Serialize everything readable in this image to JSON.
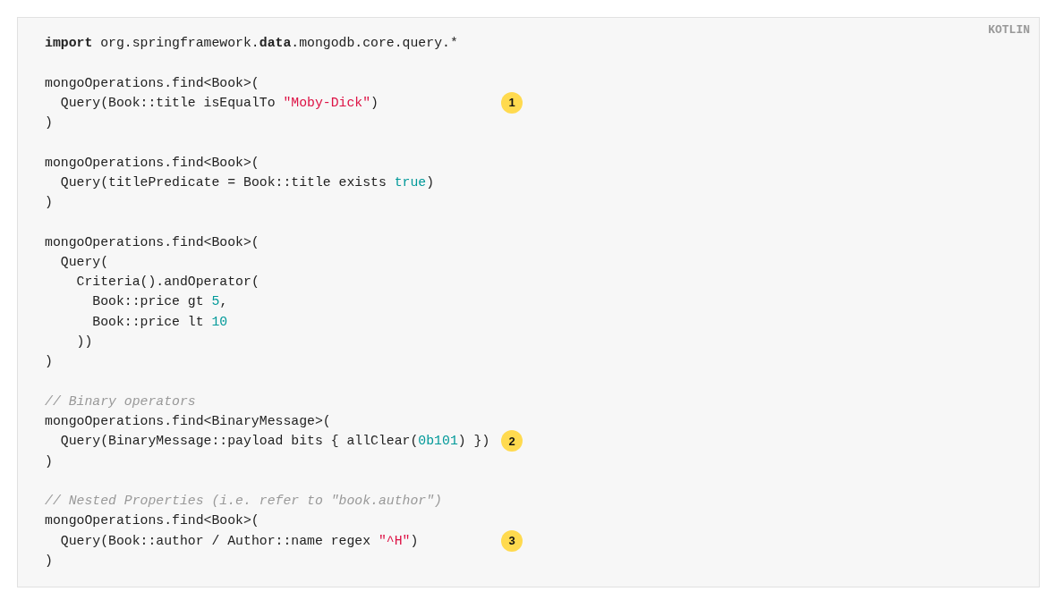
{
  "code_block": {
    "language": "KOTLIN",
    "lines": [
      {
        "kind": "code",
        "tokens": [
          {
            "kind": "keyword",
            "text": "import"
          },
          {
            "kind": "plain",
            "text": " org.springframework."
          },
          {
            "kind": "keyword",
            "text": "data"
          },
          {
            "kind": "plain",
            "text": ".mongodb.core.query.*"
          }
        ]
      },
      {
        "kind": "blank"
      },
      {
        "kind": "code",
        "tokens": [
          {
            "kind": "plain",
            "text": "mongoOperations.find<Book>("
          }
        ]
      },
      {
        "kind": "code",
        "tokens": [
          {
            "kind": "plain",
            "text": "  Query(Book::title isEqualTo "
          },
          {
            "kind": "string",
            "text": "\"Moby-Dick\""
          },
          {
            "kind": "plain",
            "text": ")"
          }
        ],
        "callout": "1"
      },
      {
        "kind": "code",
        "tokens": [
          {
            "kind": "plain",
            "text": ")"
          }
        ]
      },
      {
        "kind": "blank"
      },
      {
        "kind": "code",
        "tokens": [
          {
            "kind": "plain",
            "text": "mongoOperations.find<Book>("
          }
        ]
      },
      {
        "kind": "code",
        "tokens": [
          {
            "kind": "plain",
            "text": "  Query(titlePredicate = Book::title exists "
          },
          {
            "kind": "literal",
            "text": "true"
          },
          {
            "kind": "plain",
            "text": ")"
          }
        ]
      },
      {
        "kind": "code",
        "tokens": [
          {
            "kind": "plain",
            "text": ")"
          }
        ]
      },
      {
        "kind": "blank"
      },
      {
        "kind": "code",
        "tokens": [
          {
            "kind": "plain",
            "text": "mongoOperations.find<Book>("
          }
        ]
      },
      {
        "kind": "code",
        "tokens": [
          {
            "kind": "plain",
            "text": "  Query("
          }
        ]
      },
      {
        "kind": "code",
        "tokens": [
          {
            "kind": "plain",
            "text": "    Criteria().andOperator("
          }
        ]
      },
      {
        "kind": "code",
        "tokens": [
          {
            "kind": "plain",
            "text": "      Book::price gt "
          },
          {
            "kind": "literal",
            "text": "5"
          },
          {
            "kind": "plain",
            "text": ","
          }
        ]
      },
      {
        "kind": "code",
        "tokens": [
          {
            "kind": "plain",
            "text": "      Book::price lt "
          },
          {
            "kind": "literal",
            "text": "10"
          }
        ]
      },
      {
        "kind": "code",
        "tokens": [
          {
            "kind": "plain",
            "text": "    ))"
          }
        ]
      },
      {
        "kind": "code",
        "tokens": [
          {
            "kind": "plain",
            "text": ")"
          }
        ]
      },
      {
        "kind": "blank"
      },
      {
        "kind": "code",
        "tokens": [
          {
            "kind": "comment",
            "text": "// Binary operators"
          }
        ]
      },
      {
        "kind": "code",
        "tokens": [
          {
            "kind": "plain",
            "text": "mongoOperations.find<BinaryMessage>("
          }
        ]
      },
      {
        "kind": "code",
        "tokens": [
          {
            "kind": "plain",
            "text": "  Query(BinaryMessage::payload bits { allClear("
          },
          {
            "kind": "literal",
            "text": "0b101"
          },
          {
            "kind": "plain",
            "text": ") })"
          }
        ],
        "callout": "2"
      },
      {
        "kind": "code",
        "tokens": [
          {
            "kind": "plain",
            "text": ")"
          }
        ]
      },
      {
        "kind": "blank"
      },
      {
        "kind": "code",
        "tokens": [
          {
            "kind": "comment",
            "text": "// Nested Properties (i.e. refer to \"book.author\")"
          }
        ]
      },
      {
        "kind": "code",
        "tokens": [
          {
            "kind": "plain",
            "text": "mongoOperations.find<Book>("
          }
        ]
      },
      {
        "kind": "code",
        "tokens": [
          {
            "kind": "plain",
            "text": "  Query(Book::author / Author::name regex "
          },
          {
            "kind": "string",
            "text": "\"^H\""
          },
          {
            "kind": "plain",
            "text": ")"
          }
        ],
        "callout": "3"
      },
      {
        "kind": "code",
        "tokens": [
          {
            "kind": "plain",
            "text": ")"
          }
        ]
      }
    ]
  }
}
